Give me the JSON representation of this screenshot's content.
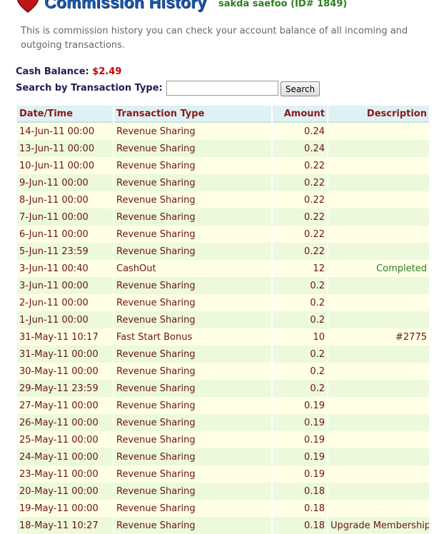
{
  "header": {
    "title": "Commission History",
    "user": "sakda saefoo (ID# 1849)",
    "logo_icon": "heart-logo-icon"
  },
  "intro": "This is commission history you can check your account balance of all incoming and outgoing transactions.",
  "balance": {
    "label": "Cash Balance:",
    "value": "$2.49"
  },
  "search": {
    "label": "Search by Transaction Type:",
    "value": "",
    "placeholder": "",
    "button_label": "Search"
  },
  "table": {
    "columns": [
      "Date/Time",
      "Transaction Type",
      "Amount",
      "Description"
    ],
    "rows": [
      {
        "date": "14-Jun-11 00:00",
        "type": "Revenue Sharing",
        "amount": "0.24",
        "desc": ""
      },
      {
        "date": "13-Jun-11 00:00",
        "type": "Revenue Sharing",
        "amount": "0.24",
        "desc": ""
      },
      {
        "date": "10-Jun-11 00:00",
        "type": "Revenue Sharing",
        "amount": "0.22",
        "desc": ""
      },
      {
        "date": "9-Jun-11 00:00",
        "type": "Revenue Sharing",
        "amount": "0.22",
        "desc": ""
      },
      {
        "date": "8-Jun-11 00:00",
        "type": "Revenue Sharing",
        "amount": "0.22",
        "desc": ""
      },
      {
        "date": "7-Jun-11 00:00",
        "type": "Revenue Sharing",
        "amount": "0.22",
        "desc": ""
      },
      {
        "date": "6-Jun-11 00:00",
        "type": "Revenue Sharing",
        "amount": "0.22",
        "desc": ""
      },
      {
        "date": "5-Jun-11 23:59",
        "type": "Revenue Sharing",
        "amount": "0.22",
        "desc": ""
      },
      {
        "date": "3-Jun-11 00:40",
        "type": "CashOut",
        "amount": "12",
        "desc": "Completed"
      },
      {
        "date": "3-Jun-11 00:00",
        "type": "Revenue Sharing",
        "amount": "0.2",
        "desc": ""
      },
      {
        "date": "2-Jun-11 00:00",
        "type": "Revenue Sharing",
        "amount": "0.2",
        "desc": ""
      },
      {
        "date": "1-Jun-11 00:00",
        "type": "Revenue Sharing",
        "amount": "0.2",
        "desc": ""
      },
      {
        "date": "31-May-11 10:17",
        "type": "Fast Start Bonus",
        "amount": "10",
        "desc": "#2775"
      },
      {
        "date": "31-May-11 00:00",
        "type": "Revenue Sharing",
        "amount": "0.2",
        "desc": ""
      },
      {
        "date": "30-May-11 00:00",
        "type": "Revenue Sharing",
        "amount": "0.2",
        "desc": ""
      },
      {
        "date": "29-May-11 23:59",
        "type": "Revenue Sharing",
        "amount": "0.2",
        "desc": ""
      },
      {
        "date": "27-May-11 00:00",
        "type": "Revenue Sharing",
        "amount": "0.19",
        "desc": ""
      },
      {
        "date": "26-May-11 00:00",
        "type": "Revenue Sharing",
        "amount": "0.19",
        "desc": ""
      },
      {
        "date": "25-May-11 00:00",
        "type": "Revenue Sharing",
        "amount": "0.19",
        "desc": ""
      },
      {
        "date": "24-May-11 00:00",
        "type": "Revenue Sharing",
        "amount": "0.19",
        "desc": ""
      },
      {
        "date": "23-May-11 00:00",
        "type": "Revenue Sharing",
        "amount": "0.19",
        "desc": ""
      },
      {
        "date": "20-May-11 00:00",
        "type": "Revenue Sharing",
        "amount": "0.18",
        "desc": ""
      },
      {
        "date": "19-May-11 00:00",
        "type": "Revenue Sharing",
        "amount": "0.18",
        "desc": ""
      },
      {
        "date": "18-May-11 10:27",
        "type": "Revenue Sharing",
        "amount": "0.18",
        "desc": "Upgrade Membership"
      }
    ]
  }
}
